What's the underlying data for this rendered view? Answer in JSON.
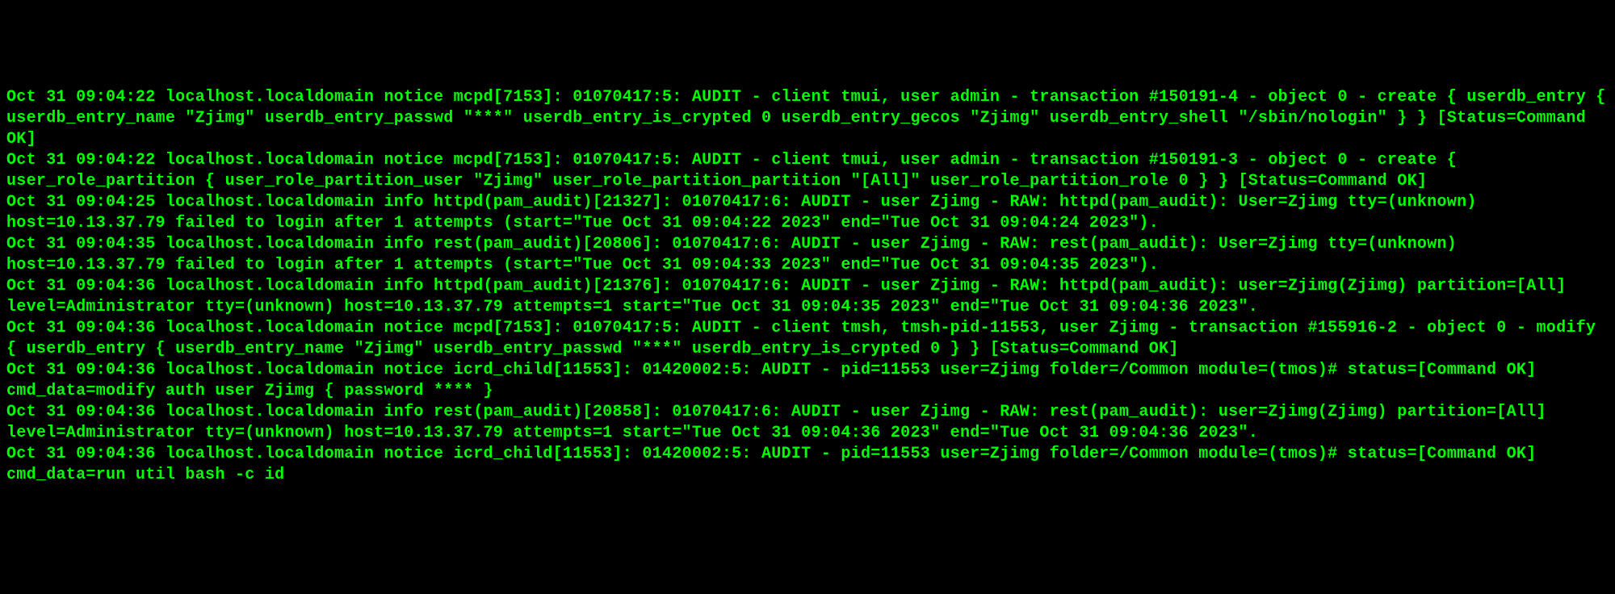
{
  "log_lines": [
    "Oct 31 09:04:22 localhost.localdomain notice mcpd[7153]: 01070417:5: AUDIT - client tmui, user admin - transaction #150191-4 - object 0 - create { userdb_entry { userdb_entry_name \"Zjimg\" userdb_entry_passwd \"***\" userdb_entry_is_crypted 0 userdb_entry_gecos \"Zjimg\" userdb_entry_shell \"/sbin/nologin\" } } [Status=Command OK]",
    "Oct 31 09:04:22 localhost.localdomain notice mcpd[7153]: 01070417:5: AUDIT - client tmui, user admin - transaction #150191-3 - object 0 - create { user_role_partition { user_role_partition_user \"Zjimg\" user_role_partition_partition \"[All]\" user_role_partition_role 0 } } [Status=Command OK]",
    "Oct 31 09:04:25 localhost.localdomain info httpd(pam_audit)[21327]: 01070417:6: AUDIT - user Zjimg - RAW: httpd(pam_audit): User=Zjimg tty=(unknown) host=10.13.37.79 failed to login after 1 attempts (start=\"Tue Oct 31 09:04:22 2023\" end=\"Tue Oct 31 09:04:24 2023\").",
    "Oct 31 09:04:35 localhost.localdomain info rest(pam_audit)[20806]: 01070417:6: AUDIT - user Zjimg - RAW: rest(pam_audit): User=Zjimg tty=(unknown) host=10.13.37.79 failed to login after 1 attempts (start=\"Tue Oct 31 09:04:33 2023\" end=\"Tue Oct 31 09:04:35 2023\").",
    "Oct 31 09:04:36 localhost.localdomain info httpd(pam_audit)[21376]: 01070417:6: AUDIT - user Zjimg - RAW: httpd(pam_audit): user=Zjimg(Zjimg) partition=[All] level=Administrator tty=(unknown) host=10.13.37.79 attempts=1 start=\"Tue Oct 31 09:04:35 2023\" end=\"Tue Oct 31 09:04:36 2023\".",
    "Oct 31 09:04:36 localhost.localdomain notice mcpd[7153]: 01070417:5: AUDIT - client tmsh, tmsh-pid-11553, user Zjimg - transaction #155916-2 - object 0 - modify { userdb_entry { userdb_entry_name \"Zjimg\" userdb_entry_passwd \"***\" userdb_entry_is_crypted 0 } } [Status=Command OK]",
    "Oct 31 09:04:36 localhost.localdomain notice icrd_child[11553]: 01420002:5: AUDIT - pid=11553 user=Zjimg folder=/Common module=(tmos)# status=[Command OK] cmd_data=modify auth user Zjimg { password **** }",
    "Oct 31 09:04:36 localhost.localdomain info rest(pam_audit)[20858]: 01070417:6: AUDIT - user Zjimg - RAW: rest(pam_audit): user=Zjimg(Zjimg) partition=[All] level=Administrator tty=(unknown) host=10.13.37.79 attempts=1 start=\"Tue Oct 31 09:04:36 2023\" end=\"Tue Oct 31 09:04:36 2023\".",
    "Oct 31 09:04:36 localhost.localdomain notice icrd_child[11553]: 01420002:5: AUDIT - pid=11553 user=Zjimg folder=/Common module=(tmos)# status=[Command OK] cmd_data=run util bash -c id"
  ]
}
